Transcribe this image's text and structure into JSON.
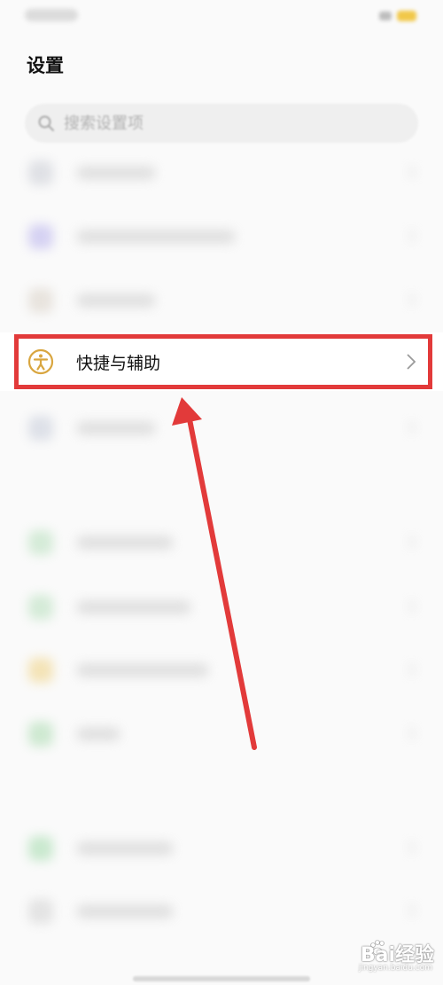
{
  "header": {
    "title": "设置"
  },
  "search": {
    "placeholder": "搜索设置项"
  },
  "highlighted_item": {
    "label": "快捷与辅助"
  },
  "colors": {
    "highlight_frame": "#e23a3a",
    "arrow": "#e23a3a",
    "accessibility_icon": "#d9a640"
  },
  "watermark": {
    "brand": "Bai经验",
    "sub": "jingyan.baidu.com"
  }
}
